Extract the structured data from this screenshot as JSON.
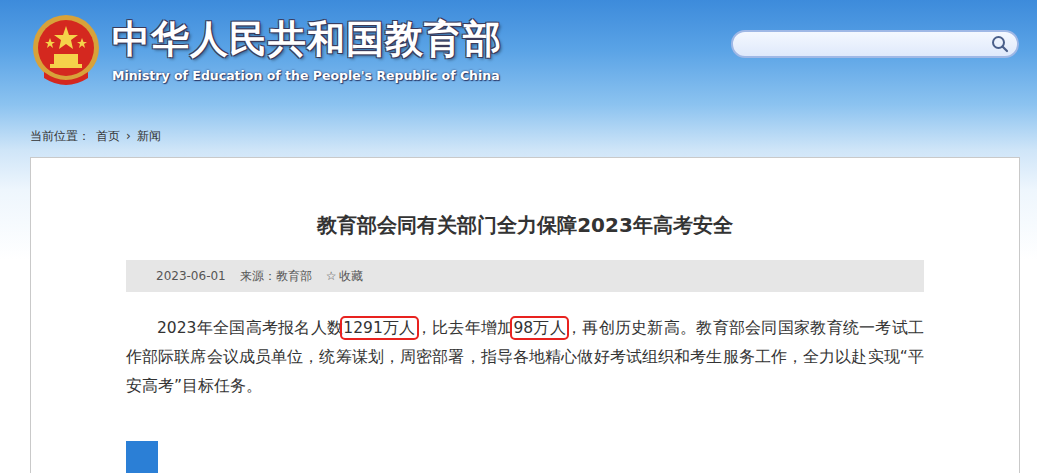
{
  "header": {
    "title": "中华人民共和国教育部",
    "subtitle": "Ministry of Education of the People's Republic of China",
    "search": {
      "placeholder": ""
    }
  },
  "breadcrumb": {
    "label": "当前位置：",
    "items": [
      "首页",
      "新闻"
    ],
    "separator": "›"
  },
  "article": {
    "title": "教育部会同有关部门全力保障2023年高考安全",
    "meta": {
      "date": "2023-06-01",
      "source": "来源：教育部",
      "favorite": "收藏",
      "favorite_icon": "☆"
    },
    "paragraph": [
      {
        "text": "2023年全国高考报名人数",
        "highlighted": false
      },
      {
        "text": "1291万人",
        "highlighted": true
      },
      {
        "text": "，比去年增加",
        "highlighted": false
      },
      {
        "text": "98万人",
        "highlighted": true
      },
      {
        "text": "，再创历史新高。教育部会同国家教育统一考试工作部际联席会议成员单位，统筹谋划，周密部署，指导各地精心做好考试组织和考生服务工作，全力以赴实现“平安高考”目标任务。",
        "highlighted": false
      }
    ]
  }
}
